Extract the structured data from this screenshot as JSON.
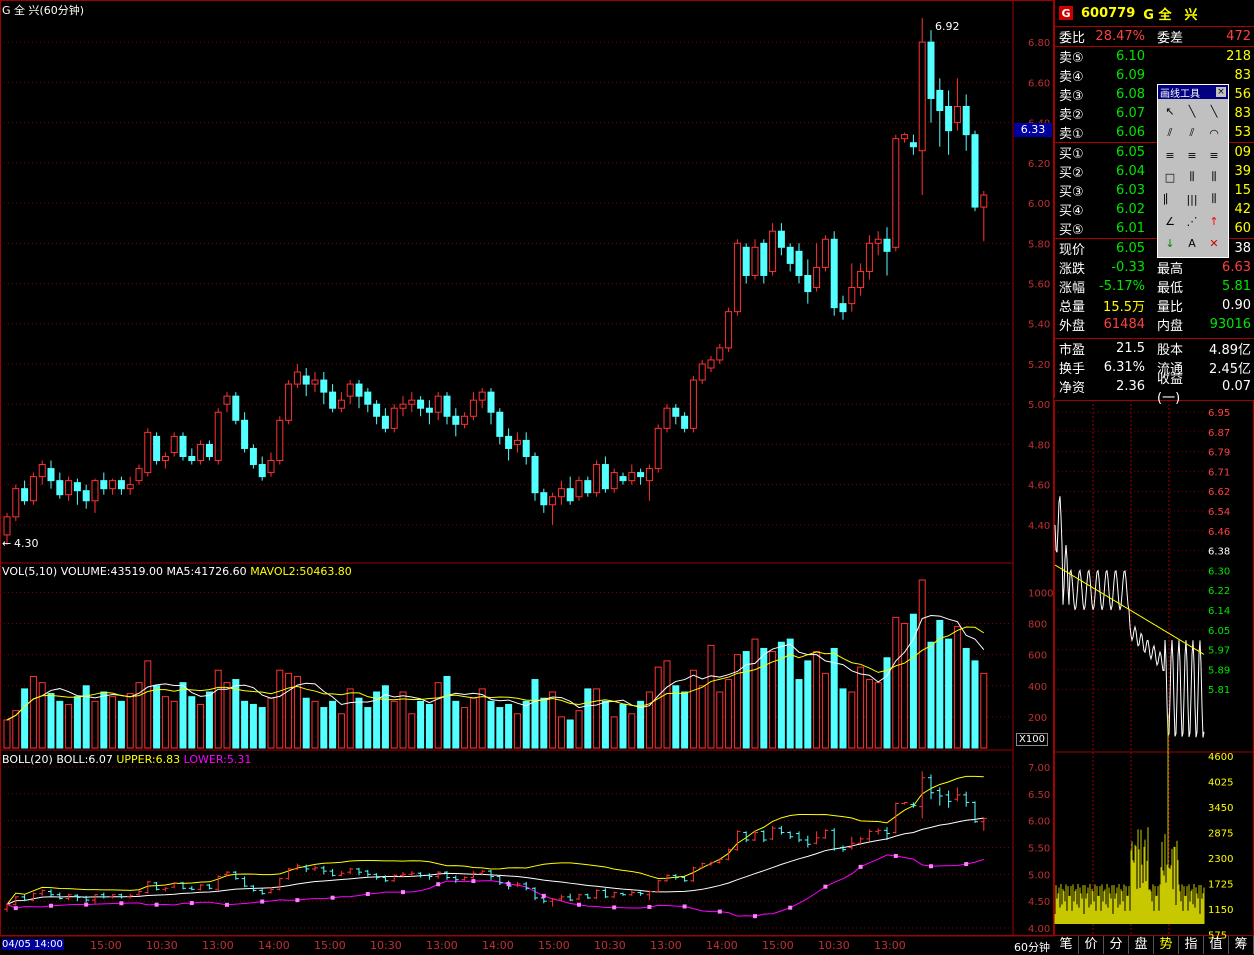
{
  "stock": {
    "code": "600779",
    "name": "G 全　兴",
    "logo": "G"
  },
  "chart_title": "G 全 兴(60分钟)",
  "current_price_marker": "6.33",
  "vol_header": {
    "label": "VOL(5,10)",
    "volume": "VOLUME:43519.00",
    "ma5": "MA5:41726.60",
    "mavol2": "MAVOL2:50463.80"
  },
  "boll_header": {
    "label": "BOLL(20)",
    "boll": "BOLL:6.07",
    "upper": "UPPER:6.83",
    "lower": "LOWER:5.31"
  },
  "vol_unit": "X100",
  "period_label": "60分钟",
  "date_label": "04/05 14:00",
  "high_label": "6.92",
  "low_label": "4.30",
  "colors": {
    "up": "#ff3232",
    "down": "#54ffff",
    "bg": "#000000",
    "grid": "#800000",
    "ma5": "#ffffff",
    "ma10": "#ffff00",
    "lower": "#ff00ff"
  },
  "quote": {
    "weibi": {
      "label": "委比",
      "value": "28.47%",
      "label2": "委差",
      "value2": "472"
    },
    "sell": [
      {
        "label": "卖⑤",
        "price": "6.10",
        "vol": "218"
      },
      {
        "label": "卖④",
        "price": "6.09",
        "vol": "83"
      },
      {
        "label": "卖③",
        "price": "6.08",
        "vol": "56"
      },
      {
        "label": "卖②",
        "price": "6.07",
        "vol": "83"
      },
      {
        "label": "卖①",
        "price": "6.06",
        "vol": "53"
      }
    ],
    "buy": [
      {
        "label": "买①",
        "price": "6.05",
        "vol": "09"
      },
      {
        "label": "买②",
        "price": "6.04",
        "vol": "39"
      },
      {
        "label": "买③",
        "price": "6.03",
        "vol": "15"
      },
      {
        "label": "买④",
        "price": "6.02",
        "vol": "42"
      },
      {
        "label": "买⑤",
        "price": "6.01",
        "vol": "60"
      }
    ],
    "stats": [
      {
        "l": "现价",
        "v": "6.05",
        "l2": "",
        "v2": "38",
        "c": "green",
        "c2": "white"
      },
      {
        "l": "涨跌",
        "v": "-0.33",
        "l2": "最高",
        "v2": "6.63",
        "c": "green",
        "c2": "red"
      },
      {
        "l": "涨幅",
        "v": "-5.17%",
        "l2": "最低",
        "v2": "5.81",
        "c": "green",
        "c2": "green"
      },
      {
        "l": "总量",
        "v": "15.5万",
        "l2": "量比",
        "v2": "0.90",
        "c": "yellow",
        "c2": "white"
      },
      {
        "l": "外盘",
        "v": "61484",
        "l2": "内盘",
        "v2": "93016",
        "c": "red",
        "c2": "green"
      }
    ],
    "stats2": [
      {
        "l": "市盈",
        "v": "21.5",
        "l2": "股本",
        "v2": "4.89亿"
      },
      {
        "l": "换手",
        "v": "6.31%",
        "l2": "流通",
        "v2": "2.45亿"
      },
      {
        "l": "净资",
        "v": "2.36",
        "l2": "收益(一)",
        "v2": "0.07"
      }
    ]
  },
  "tools": {
    "title": "画线工具",
    "close": "×",
    "icons": [
      "cursor-icon",
      "line-icon",
      "ray-icon",
      "parallel-icon",
      "channel-icon",
      "arc-icon",
      "fib-icon",
      "gann-icon",
      "level-icon",
      "rect-icon",
      "cycle-icon",
      "speed-icon",
      "period-icon",
      "multi-line-icon",
      "wave-icon",
      "angle-icon",
      "fan-icon",
      "up-arrow-icon",
      "down-arrow-icon",
      "text-icon",
      "delete-icon"
    ],
    "glyphs": [
      "↖",
      "╲",
      "╲",
      "⫽",
      "⫽",
      "◠",
      "≡",
      "≡",
      "≡",
      "□",
      "⫼",
      "⫼",
      "|⎸",
      "|||",
      "⫼",
      "∠",
      "⋰",
      "↑",
      "↓",
      "A",
      "✕"
    ]
  },
  "tabs": [
    "笔",
    "价",
    "分",
    "盘",
    "势",
    "指",
    "值",
    "筹"
  ],
  "active_tab": "势",
  "x_labels": [
    "15:00",
    "10:30",
    "13:00",
    "14:00",
    "15:00",
    "10:30",
    "13:00",
    "14:00",
    "15:00",
    "10:30",
    "13:00",
    "14:00",
    "15:00",
    "10:30",
    "13:00"
  ],
  "price_axis": [
    "6.80",
    "6.60",
    "6.40",
    "6.20",
    "6.00",
    "5.80",
    "5.60",
    "5.40",
    "5.20",
    "5.00",
    "4.80",
    "4.60",
    "4.40"
  ],
  "vol_axis": [
    "1000",
    "800",
    "600",
    "400",
    "200"
  ],
  "boll_axis": [
    "7.00",
    "6.50",
    "6.00",
    "5.50",
    "5.00",
    "4.50",
    "4.00"
  ],
  "mini_axis": [
    "6.95",
    "6.87",
    "6.79",
    "6.71",
    "6.62",
    "6.54",
    "6.46",
    "6.38",
    "6.30",
    "6.22",
    "6.14",
    "6.05",
    "5.97",
    "5.89",
    "5.81"
  ],
  "mini_vol_axis": [
    "4600",
    "4025",
    "3450",
    "2875",
    "2300",
    "1725",
    "1150",
    "575"
  ],
  "chart_data": {
    "type": "candlestick",
    "ylim": [
      4.3,
      6.92
    ],
    "candles": [
      [
        4.35,
        4.44,
        4.3,
        4.46
      ],
      [
        4.44,
        4.58,
        4.42,
        4.6
      ],
      [
        4.58,
        4.52,
        4.5,
        4.62
      ],
      [
        4.52,
        4.64,
        4.5,
        4.66
      ],
      [
        4.64,
        4.7,
        4.6,
        4.72
      ],
      [
        4.68,
        4.62,
        4.58,
        4.72
      ],
      [
        4.62,
        4.55,
        4.53,
        4.66
      ],
      [
        4.55,
        4.62,
        4.52,
        4.64
      ],
      [
        4.61,
        4.57,
        4.5,
        4.63
      ],
      [
        4.57,
        4.52,
        4.48,
        4.6
      ],
      [
        4.52,
        4.62,
        4.46,
        4.63
      ],
      [
        4.62,
        4.58,
        4.55,
        4.66
      ],
      [
        4.58,
        4.62,
        4.55,
        4.63
      ],
      [
        4.62,
        4.58,
        4.55,
        4.64
      ],
      [
        4.58,
        4.6,
        4.55,
        4.64
      ],
      [
        4.62,
        4.68,
        4.6,
        4.7
      ],
      [
        4.66,
        4.86,
        4.64,
        4.88
      ],
      [
        4.84,
        4.72,
        4.7,
        4.86
      ],
      [
        4.72,
        4.74,
        4.68,
        4.76
      ],
      [
        4.76,
        4.84,
        4.74,
        4.86
      ],
      [
        4.84,
        4.74,
        4.72,
        4.86
      ],
      [
        4.74,
        4.72,
        4.7,
        4.78
      ],
      [
        4.72,
        4.8,
        4.7,
        4.82
      ],
      [
        4.8,
        4.74,
        4.72,
        4.82
      ],
      [
        4.72,
        4.96,
        4.7,
        4.98
      ],
      [
        5.0,
        5.04,
        4.96,
        5.06
      ],
      [
        5.04,
        4.92,
        4.9,
        5.06
      ],
      [
        4.92,
        4.78,
        4.76,
        4.96
      ],
      [
        4.78,
        4.7,
        4.68,
        4.8
      ],
      [
        4.7,
        4.64,
        4.62,
        4.74
      ],
      [
        4.66,
        4.72,
        4.64,
        4.76
      ],
      [
        4.72,
        4.92,
        4.7,
        4.94
      ],
      [
        4.92,
        5.1,
        4.9,
        5.12
      ],
      [
        5.1,
        5.16,
        5.08,
        5.2
      ],
      [
        5.14,
        5.1,
        5.04,
        5.18
      ],
      [
        5.1,
        5.12,
        5.06,
        5.16
      ],
      [
        5.12,
        5.06,
        5.0,
        5.16
      ],
      [
        5.06,
        4.98,
        4.96,
        5.1
      ],
      [
        4.98,
        5.02,
        4.96,
        5.06
      ],
      [
        5.04,
        5.1,
        5.0,
        5.12
      ],
      [
        5.1,
        5.04,
        4.98,
        5.12
      ],
      [
        5.06,
        5.0,
        4.96,
        5.08
      ],
      [
        5.0,
        4.94,
        4.9,
        5.02
      ],
      [
        4.94,
        4.88,
        4.86,
        4.98
      ],
      [
        4.88,
        4.98,
        4.86,
        5.0
      ],
      [
        4.98,
        5.0,
        4.94,
        5.04
      ],
      [
        5.0,
        5.02,
        4.96,
        5.06
      ],
      [
        5.02,
        4.98,
        4.94,
        5.04
      ],
      [
        4.98,
        4.96,
        4.9,
        5.02
      ],
      [
        4.96,
        5.04,
        4.92,
        5.06
      ],
      [
        5.04,
        4.94,
        4.9,
        5.06
      ],
      [
        4.94,
        4.9,
        4.84,
        4.98
      ],
      [
        4.9,
        4.94,
        4.88,
        4.96
      ],
      [
        4.94,
        5.02,
        4.92,
        5.06
      ],
      [
        5.02,
        5.06,
        4.98,
        5.08
      ],
      [
        5.06,
        4.96,
        4.9,
        5.08
      ],
      [
        4.96,
        4.84,
        4.8,
        4.98
      ],
      [
        4.84,
        4.78,
        4.72,
        4.88
      ],
      [
        4.8,
        4.82,
        4.76,
        4.86
      ],
      [
        4.82,
        4.74,
        4.7,
        4.86
      ],
      [
        4.74,
        4.56,
        4.52,
        4.76
      ],
      [
        4.56,
        4.5,
        4.46,
        4.58
      ],
      [
        4.5,
        4.54,
        4.4,
        4.56
      ],
      [
        4.54,
        4.58,
        4.5,
        4.62
      ],
      [
        4.58,
        4.52,
        4.5,
        4.64
      ],
      [
        4.54,
        4.62,
        4.52,
        4.64
      ],
      [
        4.62,
        4.56,
        4.54,
        4.64
      ],
      [
        4.56,
        4.7,
        4.54,
        4.72
      ],
      [
        4.7,
        4.58,
        4.56,
        4.74
      ],
      [
        4.58,
        4.66,
        4.56,
        4.68
      ],
      [
        4.64,
        4.62,
        4.6,
        4.66
      ],
      [
        4.62,
        4.66,
        4.6,
        4.7
      ],
      [
        4.66,
        4.64,
        4.6,
        4.68
      ],
      [
        4.62,
        4.68,
        4.52,
        4.7
      ],
      [
        4.68,
        4.88,
        4.66,
        4.9
      ],
      [
        4.88,
        4.98,
        4.86,
        5.0
      ],
      [
        4.98,
        4.94,
        4.9,
        5.0
      ],
      [
        4.94,
        4.88,
        4.86,
        4.96
      ],
      [
        4.88,
        5.12,
        4.86,
        5.14
      ],
      [
        5.12,
        5.2,
        5.1,
        5.22
      ],
      [
        5.18,
        5.22,
        5.16,
        5.24
      ],
      [
        5.22,
        5.28,
        5.2,
        5.3
      ],
      [
        5.28,
        5.46,
        5.26,
        5.48
      ],
      [
        5.46,
        5.8,
        5.44,
        5.82
      ],
      [
        5.78,
        5.64,
        5.6,
        5.8
      ],
      [
        5.64,
        5.78,
        5.62,
        5.82
      ],
      [
        5.8,
        5.64,
        5.6,
        5.82
      ],
      [
        5.66,
        5.86,
        5.64,
        5.9
      ],
      [
        5.86,
        5.78,
        5.74,
        5.9
      ],
      [
        5.78,
        5.7,
        5.66,
        5.8
      ],
      [
        5.76,
        5.64,
        5.6,
        5.8
      ],
      [
        5.64,
        5.56,
        5.5,
        5.72
      ],
      [
        5.58,
        5.68,
        5.56,
        5.8
      ],
      [
        5.68,
        5.82,
        5.66,
        5.84
      ],
      [
        5.82,
        5.48,
        5.44,
        5.86
      ],
      [
        5.5,
        5.46,
        5.42,
        5.54
      ],
      [
        5.5,
        5.58,
        5.46,
        5.7
      ],
      [
        5.58,
        5.66,
        5.54,
        5.7
      ],
      [
        5.66,
        5.8,
        5.62,
        5.84
      ],
      [
        5.8,
        5.82,
        5.74,
        5.86
      ],
      [
        5.82,
        5.76,
        5.64,
        5.88
      ],
      [
        5.78,
        6.32,
        5.76,
        6.34
      ],
      [
        6.32,
        6.34,
        6.3,
        6.35
      ],
      [
        6.3,
        6.28,
        6.24,
        6.34
      ],
      [
        6.26,
        6.8,
        6.04,
        6.92
      ],
      [
        6.8,
        6.52,
        6.4,
        6.86
      ],
      [
        6.56,
        6.46,
        6.28,
        6.62
      ],
      [
        6.48,
        6.36,
        6.24,
        6.56
      ],
      [
        6.4,
        6.48,
        6.36,
        6.62
      ],
      [
        6.48,
        6.34,
        6.26,
        6.54
      ],
      [
        6.34,
        5.98,
        5.96,
        6.36
      ],
      [
        5.98,
        6.04,
        5.81,
        6.06
      ]
    ],
    "volumes": [
      180,
      240,
      380,
      460,
      420,
      350,
      300,
      280,
      330,
      400,
      300,
      360,
      330,
      300,
      350,
      420,
      560,
      400,
      330,
      300,
      420,
      330,
      280,
      360,
      500,
      420,
      440,
      300,
      280,
      260,
      320,
      500,
      480,
      460,
      320,
      300,
      260,
      300,
      220,
      380,
      320,
      260,
      360,
      400,
      300,
      360,
      220,
      300,
      280,
      420,
      460,
      300,
      260,
      320,
      380,
      300,
      260,
      280,
      220,
      300,
      440,
      320,
      360,
      200,
      180,
      240,
      380,
      380,
      300,
      200,
      280,
      220,
      300,
      360,
      520,
      560,
      400,
      360,
      500,
      400,
      660,
      360,
      440,
      600,
      620,
      700,
      640,
      620,
      680,
      700,
      440,
      560,
      620,
      480,
      640,
      380,
      360,
      520,
      440,
      420,
      580,
      840,
      800,
      860,
      1080,
      680,
      820,
      700,
      780,
      640,
      560,
      480
    ],
    "vol_ylim": [
      0,
      1080
    ],
    "boll_ylim": [
      4.0,
      7.0
    ]
  }
}
